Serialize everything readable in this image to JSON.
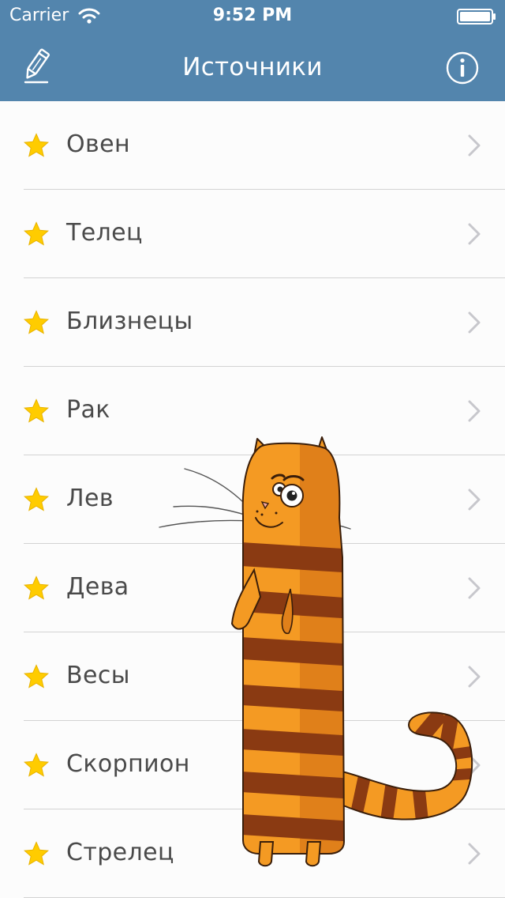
{
  "status_bar": {
    "carrier": "Carrier",
    "time": "9:52 PM",
    "wifi_icon": "wifi-icon",
    "battery_icon": "battery-icon"
  },
  "nav": {
    "title": "Источники",
    "edit_icon": "pencil-icon",
    "info_icon": "info-icon"
  },
  "colors": {
    "nav_background": "#5385ad",
    "star": "#ffcc00",
    "text": "#4a4a4a",
    "separator": "#d3d3d3",
    "chevron": "#c7c7cc"
  },
  "list": {
    "items": [
      {
        "label": "Овен",
        "icon": "star-icon"
      },
      {
        "label": "Телец",
        "icon": "star-icon"
      },
      {
        "label": "Близнецы",
        "icon": "star-icon"
      },
      {
        "label": "Рак",
        "icon": "star-icon"
      },
      {
        "label": "Лев",
        "icon": "star-icon"
      },
      {
        "label": "Дева",
        "icon": "star-icon"
      },
      {
        "label": "Весы",
        "icon": "star-icon"
      },
      {
        "label": "Скорпион",
        "icon": "star-icon"
      },
      {
        "label": "Стрелец",
        "icon": "star-icon"
      }
    ]
  },
  "illustration": "cat-illustration"
}
